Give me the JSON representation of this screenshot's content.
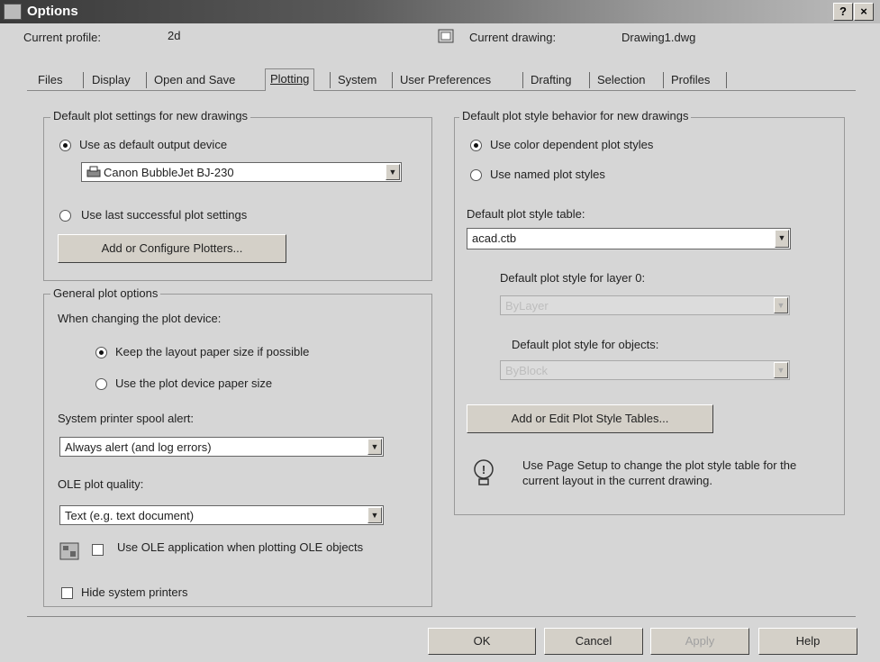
{
  "window": {
    "title": "Options",
    "help_glyph": "?",
    "close_glyph": "×"
  },
  "header": {
    "profile_label": "Current profile:",
    "profile_value": "2d",
    "drawing_label": "Current drawing:",
    "drawing_value": "Drawing1.dwg"
  },
  "tabs": [
    {
      "label": "Files"
    },
    {
      "label": "Display"
    },
    {
      "label": "Open and Save"
    },
    {
      "label": "Plotting"
    },
    {
      "label": "System"
    },
    {
      "label": "User Preferences"
    },
    {
      "label": "Drafting"
    },
    {
      "label": "Selection"
    },
    {
      "label": "Profiles"
    }
  ],
  "left": {
    "default_group_label": "Default plot settings for new drawings",
    "use_default_device_label": "Use as default output device",
    "device_value": "Canon BubbleJet BJ-230",
    "use_last_label": "Use last successful plot settings",
    "add_plotters_button": "Add or Configure Plotters...",
    "general_group_label": "General plot options",
    "when_changing_label": "When changing the plot device:",
    "keep_layout_label": "Keep the layout paper size if possible",
    "use_device_paper_label": "Use the plot device paper size",
    "spool_label": "System printer spool alert:",
    "spool_value": "Always alert (and log errors)",
    "ole_quality_label": "OLE plot quality:",
    "ole_quality_value": "Text (e.g. text document)",
    "use_ole_app_label": "Use OLE application when plotting OLE objects",
    "hide_printers_label": "Hide system printers"
  },
  "right": {
    "group_label": "Default plot style behavior for new drawings",
    "color_dependent_label": "Use color dependent plot styles",
    "named_label": "Use named plot styles",
    "style_table_label": "Default plot style table:",
    "style_table_value": "acad.ctb",
    "layer0_label": "Default plot style for layer 0:",
    "layer0_value": "ByLayer",
    "objects_label": "Default plot style for objects:",
    "objects_value": "ByBlock",
    "edit_tables_button": "Add or Edit Plot Style Tables...",
    "info_text": "Use Page Setup to change the plot style table for the current layout in the current drawing."
  },
  "footer": {
    "ok": "OK",
    "cancel": "Cancel",
    "apply": "Apply",
    "help": "Help"
  },
  "icons": {
    "info": "lightbulb-info-icon",
    "ole": "ole-app-icon",
    "printer": "printer-icon"
  }
}
